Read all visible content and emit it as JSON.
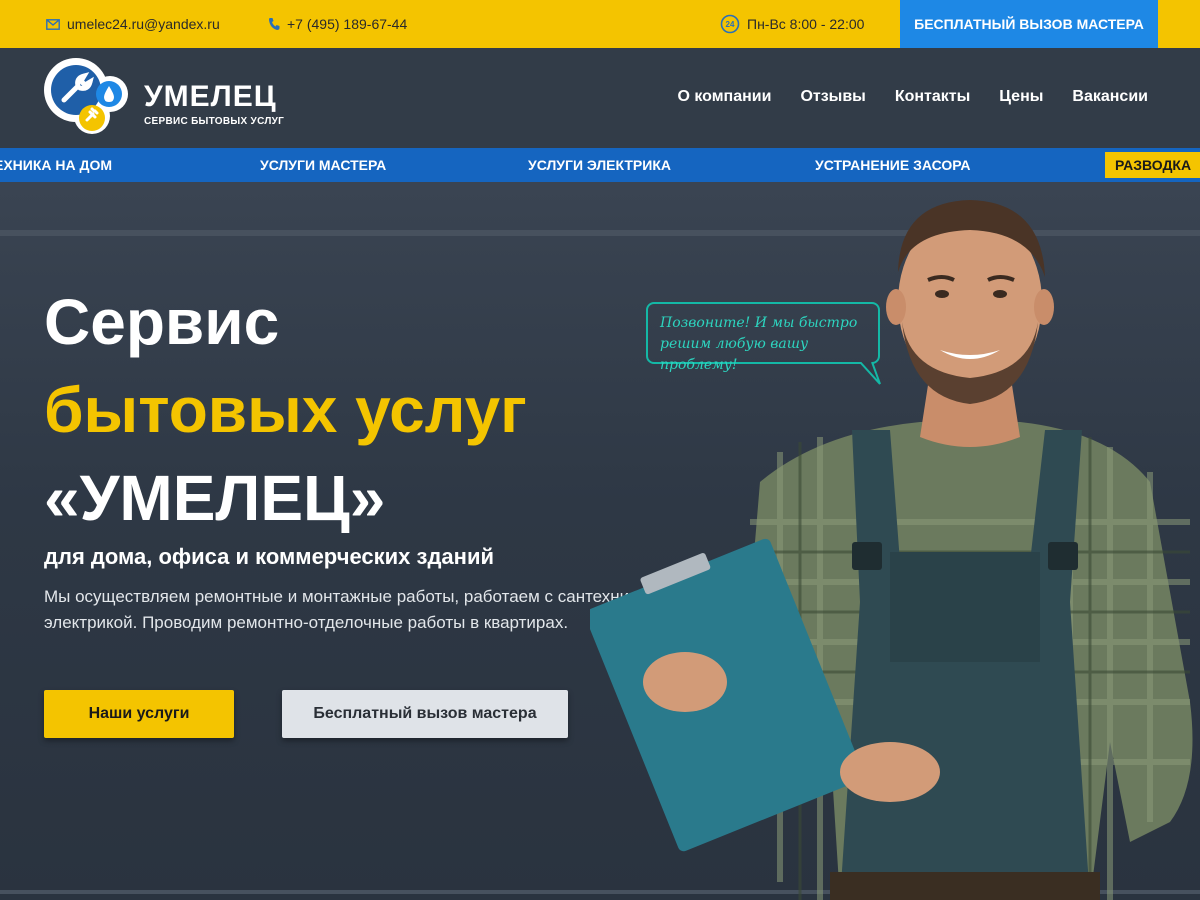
{
  "topbar": {
    "email": "umelec24.ru@yandex.ru",
    "phone": "+7 (495) 189-67-44",
    "hours": "Пн-Вс 8:00 - 22:00",
    "hours_badge": "24",
    "cta": "БЕСПЛАТНЫЙ ВЫЗОВ МАСТЕРА"
  },
  "logo": {
    "title": "УМЕЛЕЦ",
    "subtitle": "СЕРВИС БЫТОВЫХ УСЛУГ"
  },
  "nav": {
    "items": [
      "О компании",
      "Отзывы",
      "Контакты",
      "Цены",
      "Вакансии"
    ]
  },
  "services": {
    "items": [
      "ЕХНИКА НА ДОМ",
      "УСЛУГИ МАСТЕРА",
      "УСЛУГИ ЭЛЕКТРИКА",
      "УСТРАНЕНИЕ ЗАСОРА",
      "РАЗВОДКА"
    ],
    "highlight_color": "#f4c400"
  },
  "hero": {
    "line1": "Сервис",
    "line2": "бытовых услуг",
    "line3": "«УМЕЛЕЦ»",
    "subtitle": "для дома, офиса и коммерческих зданий",
    "description": "Мы осуществляем ремонтные и монтажные работы, работаем с сантехникой и электрикой. Проводим ремонтно-отделочные работы в квартирах.",
    "btn_primary": "Наши услуги",
    "btn_secondary": "Бесплатный вызов мастера",
    "bubble": "Позвоните! И мы быстро решим любую вашу проблему!"
  },
  "colors": {
    "accent_yellow": "#f4c400",
    "accent_blue": "#1e88e5",
    "strip_blue": "#1565c0",
    "bubble_teal": "#14b8a6",
    "background": "#2d3642"
  },
  "icons": {
    "email": "mail-icon",
    "phone": "phone-icon",
    "hours": "clock-24-icon",
    "logo": "wrench-drop-plug-logo"
  }
}
